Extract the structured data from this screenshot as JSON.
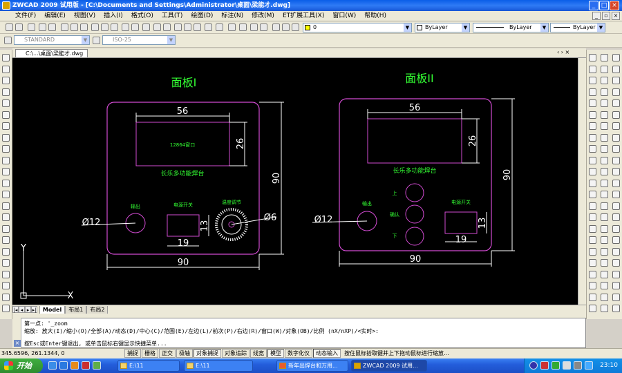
{
  "window": {
    "title": "ZWCAD 2009 试用版 - [C:\\Documents and Settings\\Administrator\\桌面\\梁能才.dwg]"
  },
  "menu": [
    "文件(F)",
    "编辑(E)",
    "视图(V)",
    "插入(I)",
    "格式(O)",
    "工具(T)",
    "绘图(D)",
    "标注(N)",
    "修改(M)",
    "ET扩展工具(X)",
    "窗口(W)",
    "帮助(H)"
  ],
  "toolbar2": {
    "layer_value": "0",
    "color_value": "ByLayer",
    "linetype_value": "ByLayer",
    "lineweight_value": "ByLayer"
  },
  "toolbar3": {
    "textstyle_value": "STANDARD",
    "dimstyle_value": "ISO-25"
  },
  "document": {
    "tab_label": "C:\\...\\桌面\\梁能才.dwg"
  },
  "drawing": {
    "panel1": {
      "title": "面板I",
      "dim_top": "56",
      "dim_screen_h": "26",
      "dim_height": "90",
      "dim_width": "90",
      "screen_label": "12864窗口",
      "brand_label": "长乐多功能焊台",
      "output_label": "输出",
      "power_label": "电源开关",
      "temp_label": "温度调节",
      "dim_hole_left": "Ø12",
      "dim_hole_right": "Ø6",
      "dim_switch_w": "19",
      "dim_switch_h": "13"
    },
    "panel2": {
      "title": "面板II",
      "dim_top": "56",
      "dim_screen_h": "26",
      "dim_height": "90",
      "dim_width": "90",
      "brand_label": "长乐多功能焊台",
      "output_label": "输出",
      "power_label": "电源开关",
      "up_label": "上",
      "confirm_label": "确认",
      "down_label": "下",
      "dim_hole_left": "Ø12",
      "dim_switch_w": "19",
      "dim_switch_h": "13"
    },
    "ucs": {
      "x": "X",
      "y": "Y"
    },
    "colors": {
      "background": "#000000",
      "outline": "#d24bd2",
      "dimension": "#ffffff",
      "label": "#33ff33"
    }
  },
  "layout_tabs": [
    "Model",
    "布局1",
    "布局2"
  ],
  "command": {
    "line1": "第一点: '_zoom",
    "line2": "缩放: 放大(I)/缩小(O)/全部(A)/动态(D)/中心(C)/范围(E)/左边(L)/前次(P)/右边(R)/窗口(W)/对象(OB)/比例 (nX/nXP)/<实时>:",
    "line3": "按Esc或Enter键退出, 或单击鼠标右键显示快捷菜单..."
  },
  "status": {
    "coords": "345.6596, 261.1344, 0",
    "buttons": [
      "捕捉",
      "栅格",
      "正交",
      "极轴",
      "对象捕捉",
      "对象追踪",
      "线宽",
      "模型",
      "数字化仪",
      "动态输入"
    ],
    "hint": "按住鼠标拾取键并上下拖动鼠标进行缩放..."
  },
  "taskbar": {
    "start": "开始",
    "tasks": [
      "E:\\11",
      "E:\\11",
      "新年出焊台和万用...",
      "ZWCAD 2009 试用..."
    ],
    "clock": "23:10"
  }
}
